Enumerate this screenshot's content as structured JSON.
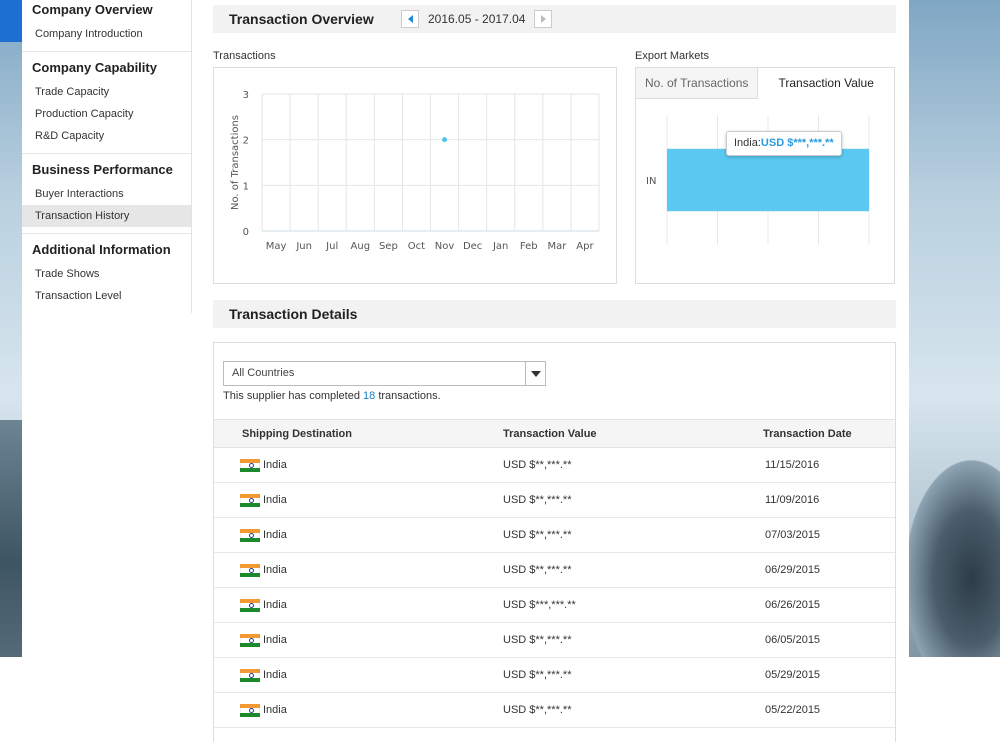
{
  "sidebar": {
    "groups": [
      {
        "title": "Company Overview",
        "items": [
          "Company Introduction"
        ]
      },
      {
        "title": "Company Capability",
        "items": [
          "Trade Capacity",
          "Production Capacity",
          "R&D Capacity"
        ]
      },
      {
        "title": "Business Performance",
        "items": [
          "Buyer Interactions",
          "Transaction History"
        ]
      },
      {
        "title": "Additional Information",
        "items": [
          "Trade Shows",
          "Transaction Level"
        ]
      }
    ],
    "active_item": "Transaction History"
  },
  "overview": {
    "title": "Transaction Overview",
    "date_range": "2016.05 - 2017.04"
  },
  "transactions_chart": {
    "label": "Transactions"
  },
  "export_markets": {
    "label": "Export Markets",
    "tabs": [
      "No. of Transactions",
      "Transaction Value"
    ],
    "active_tab": "Transaction Value",
    "tooltip_country": "India:",
    "tooltip_value": "USD $***,***.**"
  },
  "chart_data": [
    {
      "type": "line",
      "ylabel": "No. of Transactions",
      "xlabel": "",
      "categories": [
        "May",
        "Jun",
        "Jul",
        "Aug",
        "Sep",
        "Oct",
        "Nov",
        "Dec",
        "Jan",
        "Feb",
        "Mar",
        "Apr"
      ],
      "yticks": [
        "0",
        "1",
        "2",
        "3"
      ],
      "ylim": [
        0,
        3
      ],
      "series": [
        {
          "values": [
            null,
            null,
            null,
            null,
            null,
            null,
            2,
            null,
            null,
            null,
            null,
            null
          ]
        }
      ],
      "grid": true,
      "color": "#4fc3ea"
    },
    {
      "type": "bar",
      "orientation": "horizontal",
      "categories": [
        "IN"
      ],
      "values": [
        1
      ],
      "grid": true,
      "color": "#5bc8f2"
    }
  ],
  "details": {
    "title": "Transaction Details",
    "filter_value": "All Countries",
    "summary_prefix": "This supplier has completed ",
    "summary_count": "18",
    "summary_suffix": " transactions.",
    "columns": [
      "Shipping Destination",
      "Transaction Value",
      "Transaction Date"
    ],
    "rows": [
      {
        "country": "India",
        "value": "USD $**,***.**",
        "date": "11/15/2016"
      },
      {
        "country": "India",
        "value": "USD $**,***.**",
        "date": "11/09/2016"
      },
      {
        "country": "India",
        "value": "USD $**,***.**",
        "date": "07/03/2015"
      },
      {
        "country": "India",
        "value": "USD $**,***.**",
        "date": "06/29/2015"
      },
      {
        "country": "India",
        "value": "USD $***,***.**",
        "date": "06/26/2015"
      },
      {
        "country": "India",
        "value": "USD $**,***.**",
        "date": "06/05/2015"
      },
      {
        "country": "India",
        "value": "USD $**,***.**",
        "date": "05/29/2015"
      },
      {
        "country": "India",
        "value": "USD $**,***.**",
        "date": "05/22/2015"
      }
    ]
  }
}
